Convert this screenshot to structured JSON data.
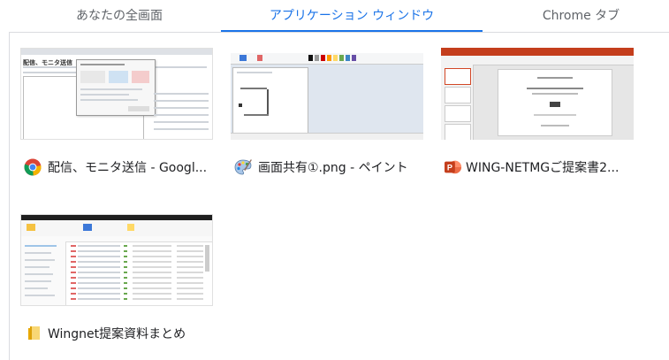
{
  "tabs": [
    {
      "label": "あなたの全画面",
      "active": false
    },
    {
      "label": "アプリケーション ウィンドウ",
      "active": true
    },
    {
      "label": "Chrome タブ",
      "active": false
    }
  ],
  "windows": [
    {
      "title": "配信、モニタ送信 - Googl...",
      "icon": "chrome-icon",
      "thumb_heading": "配信、モニタ送信"
    },
    {
      "title": "画面共有①.png - ペイント",
      "icon": "paint-palette-icon"
    },
    {
      "title": "WING-NETMGご提案書2...",
      "icon": "powerpoint-icon"
    },
    {
      "title": "Wingnet提案資料まとめ",
      "icon": "folder-icon"
    }
  ],
  "colors": {
    "accent": "#1a73e8",
    "powerpoint": "#d24726",
    "folder": "#f5c242"
  }
}
